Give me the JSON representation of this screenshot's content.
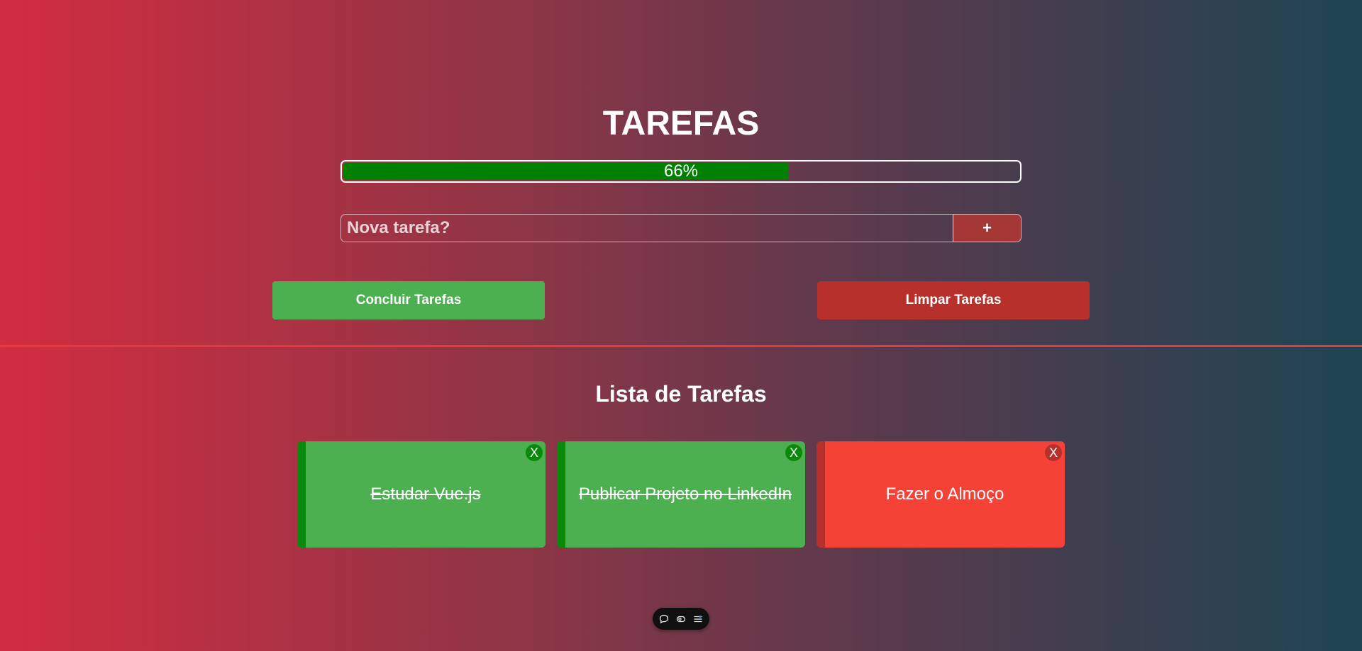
{
  "header": {
    "title": "TAREFAS"
  },
  "progress": {
    "percent": 66,
    "label": "66%",
    "fill_color": "#008000"
  },
  "new_task": {
    "placeholder": "Nova tarefa?",
    "value": "",
    "add_label": "+"
  },
  "actions": {
    "complete_label": "Concluir Tarefas",
    "clear_label": "Limpar Tarefas"
  },
  "list": {
    "title": "Lista de Tarefas",
    "tasks": [
      {
        "text": "Estudar Vue.js",
        "done": true,
        "close_label": "X"
      },
      {
        "text": "Publicar Projeto no LinkedIn",
        "done": true,
        "close_label": "X"
      },
      {
        "text": "Fazer o Almoço",
        "done": false,
        "close_label": "X"
      }
    ]
  },
  "toolbar": {
    "icons": [
      "chat-icon",
      "eye-icon",
      "settings-sliders-icon"
    ]
  },
  "colors": {
    "done": "#4caf50",
    "done_accent": "#0a8a0a",
    "pending": "#f44336",
    "pending_accent": "#b8302b",
    "divider": "#e6393b"
  }
}
